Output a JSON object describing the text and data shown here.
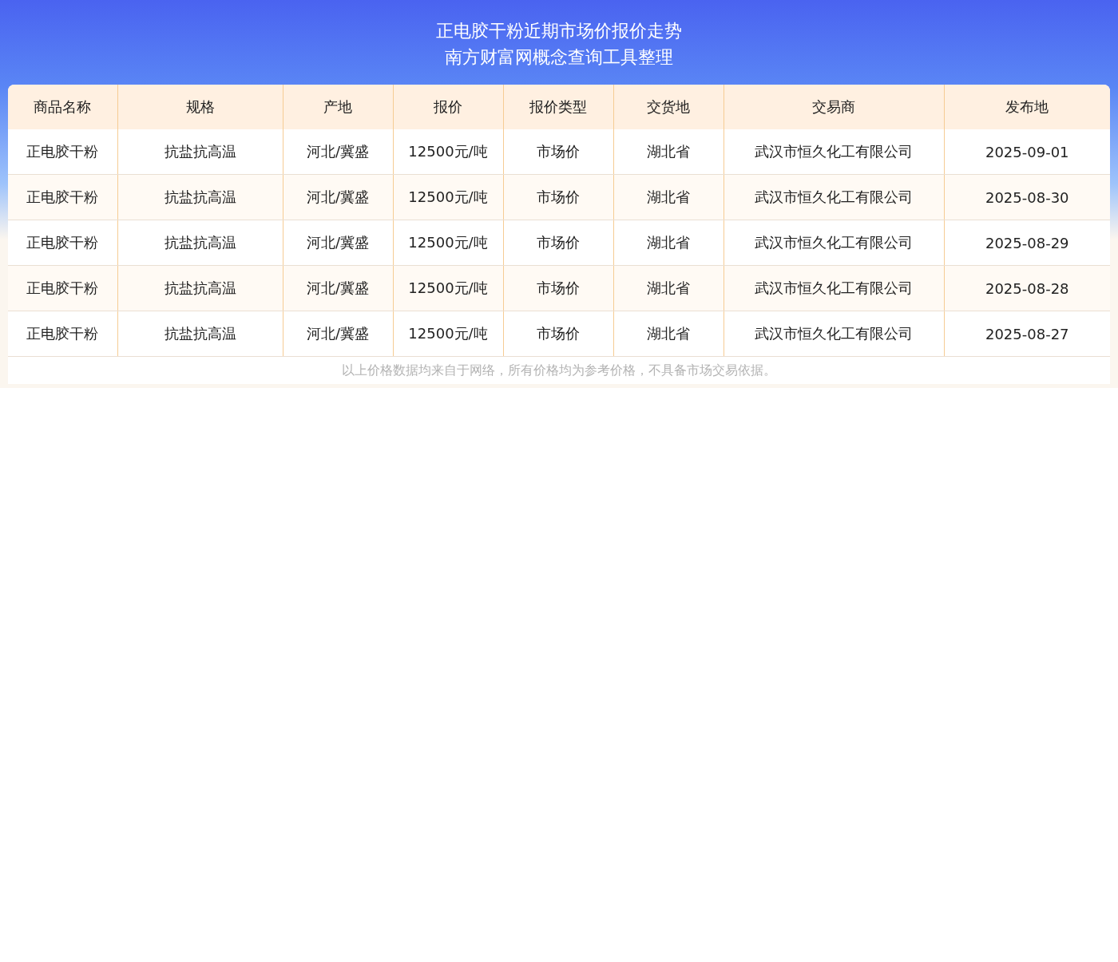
{
  "header": {
    "title": "正电胶干粉近期市场价报价走势",
    "subtitle": "南方财富网概念查询工具整理"
  },
  "table": {
    "columns": [
      "商品名称",
      "规格",
      "产地",
      "报价",
      "报价类型",
      "交货地",
      "交易商",
      "发布地"
    ],
    "rows": [
      [
        "正电胶干粉",
        "抗盐抗高温",
        "河北/冀盛",
        "12500元/吨",
        "市场价",
        "湖北省",
        "武汉市恒久化工有限公司",
        "2025-09-01"
      ],
      [
        "正电胶干粉",
        "抗盐抗高温",
        "河北/冀盛",
        "12500元/吨",
        "市场价",
        "湖北省",
        "武汉市恒久化工有限公司",
        "2025-08-30"
      ],
      [
        "正电胶干粉",
        "抗盐抗高温",
        "河北/冀盛",
        "12500元/吨",
        "市场价",
        "湖北省",
        "武汉市恒久化工有限公司",
        "2025-08-29"
      ],
      [
        "正电胶干粉",
        "抗盐抗高温",
        "河北/冀盛",
        "12500元/吨",
        "市场价",
        "湖北省",
        "武汉市恒久化工有限公司",
        "2025-08-28"
      ],
      [
        "正电胶干粉",
        "抗盐抗高温",
        "河北/冀盛",
        "12500元/吨",
        "市场价",
        "湖北省",
        "武汉市恒久化工有限公司",
        "2025-08-27"
      ]
    ]
  },
  "note": "以上价格数据均来自于网络，所有价格均为参考价格，不具备市场交易依据。"
}
